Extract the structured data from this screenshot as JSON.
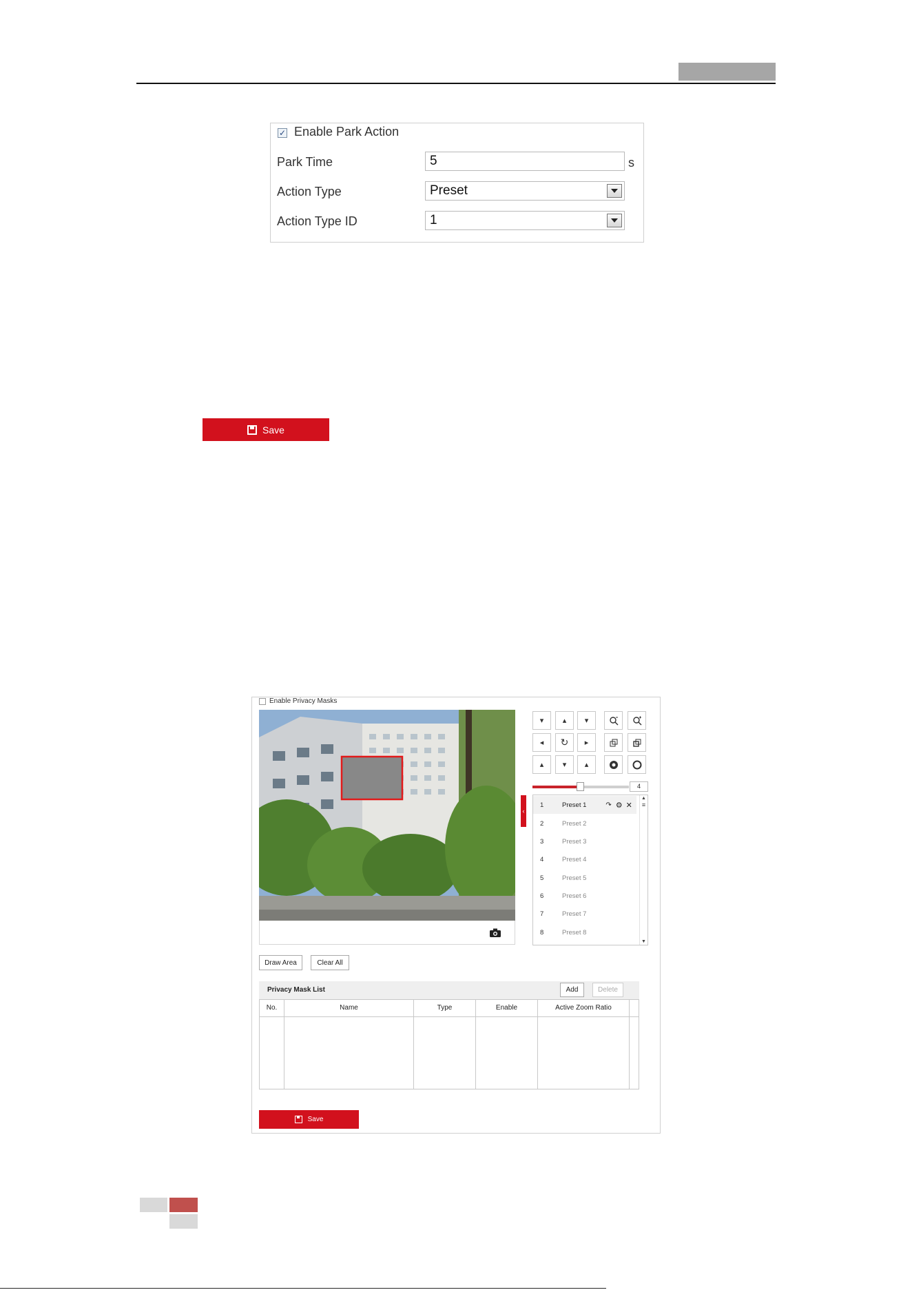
{
  "park_action": {
    "enable_label": "Enable Park Action",
    "enable_checked": true,
    "park_time_label": "Park Time",
    "park_time_value": "5",
    "park_time_unit": "s",
    "action_type_label": "Action Type",
    "action_type_value": "Preset",
    "action_type_id_label": "Action Type ID",
    "action_type_id_value": "1"
  },
  "save_button_1": {
    "label": "Save"
  },
  "privacy": {
    "enable_label": "Enable Privacy Masks",
    "zoom_value": "4",
    "zoom_level_fraction": 0.5,
    "presets": [
      {
        "num": "1",
        "name": "Preset 1"
      },
      {
        "num": "2",
        "name": "Preset 2"
      },
      {
        "num": "3",
        "name": "Preset 3"
      },
      {
        "num": "4",
        "name": "Preset 4"
      },
      {
        "num": "5",
        "name": "Preset 5"
      },
      {
        "num": "6",
        "name": "Preset 6"
      },
      {
        "num": "7",
        "name": "Preset 7"
      },
      {
        "num": "8",
        "name": "Preset 8"
      }
    ],
    "draw_area_label": "Draw Area",
    "clear_all_label": "Clear All",
    "list_title": "Privacy Mask List",
    "add_label": "Add",
    "delete_label": "Delete",
    "columns": [
      "No.",
      "Name",
      "Type",
      "Enable",
      "Active Zoom Ratio"
    ],
    "save_label": "Save"
  },
  "colors": {
    "accent_red": "#d2111d",
    "mask_gray": "#888888"
  }
}
